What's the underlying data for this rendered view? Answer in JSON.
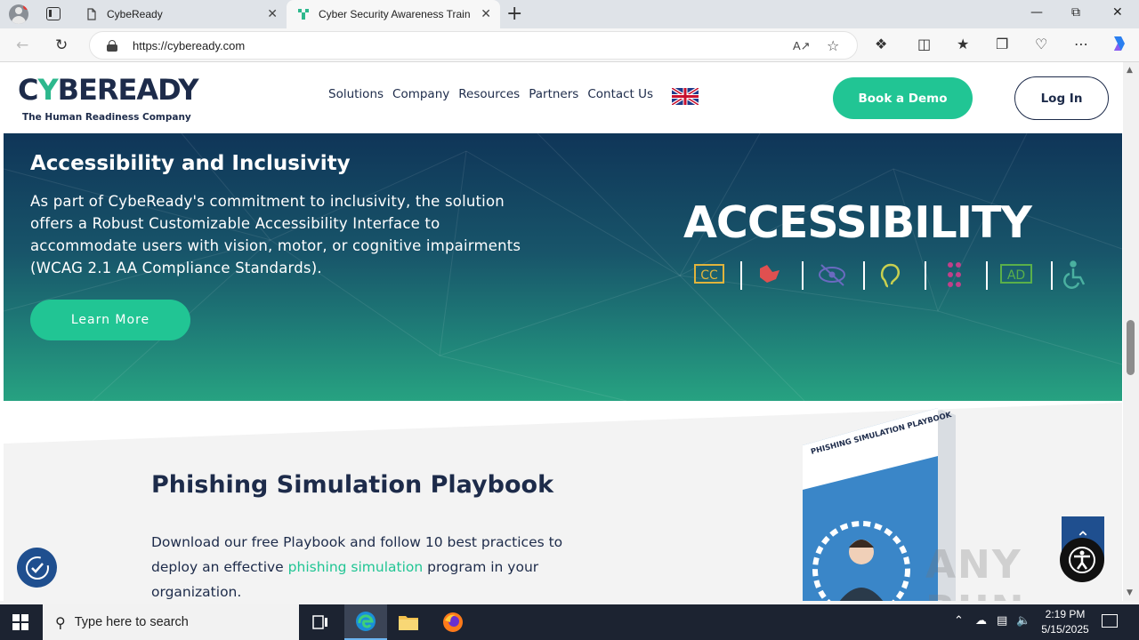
{
  "browser": {
    "tabs": [
      {
        "title": "CybeReady",
        "active": false
      },
      {
        "title": "Cyber Security Awareness Training",
        "active": true
      }
    ],
    "url": "https://cybeready.com",
    "new_tab_symbol": "+",
    "close_symbol": "✕"
  },
  "header": {
    "logo_text_a": "C",
    "logo_text_y": "Y",
    "logo_text_b": "BEREADY",
    "logo_tagline": "The Human Readiness Company",
    "menu": [
      "Solutions",
      "Company",
      "Resources",
      "Partners",
      "Contact Us"
    ],
    "demo_button": "Book a Demo",
    "login_button": "Log In"
  },
  "hero": {
    "title": "Accessibility and Inclusivity",
    "body": "As part of CybeReady's commitment to inclusivity, the solution offers a Robust Customizable Accessibility Interface to accommodate users with vision, motor, or cognitive impairments (WCAG 2.1 AA Compliance Standards).",
    "button": "Learn More",
    "banner_title": "ACCESSIBILITY",
    "banner_icons": [
      "cc-icon",
      "sign-language-icon",
      "eye-slash-icon",
      "ear-icon",
      "braille-icon",
      "audio-description-icon",
      "wheelchair-icon"
    ],
    "banner_icon_labels": {
      "cc": "CC",
      "ad": "AD"
    },
    "colors": {
      "accent": "#21c594",
      "navy": "#1d2b4a"
    }
  },
  "playbook": {
    "title": "Phishing Simulation Playbook",
    "body_before": "Download our free Playbook and follow 10 best practices to deploy an effective ",
    "link": "phishing simulation",
    "body_after": " program in your organization.",
    "book_cover_title": "PHISHING SIMULATION PLAYBOOK"
  },
  "taskbar": {
    "search_placeholder": "Type here to search",
    "time": "2:19 PM",
    "date": "5/15/2025"
  },
  "watermark": "ANY RUN"
}
